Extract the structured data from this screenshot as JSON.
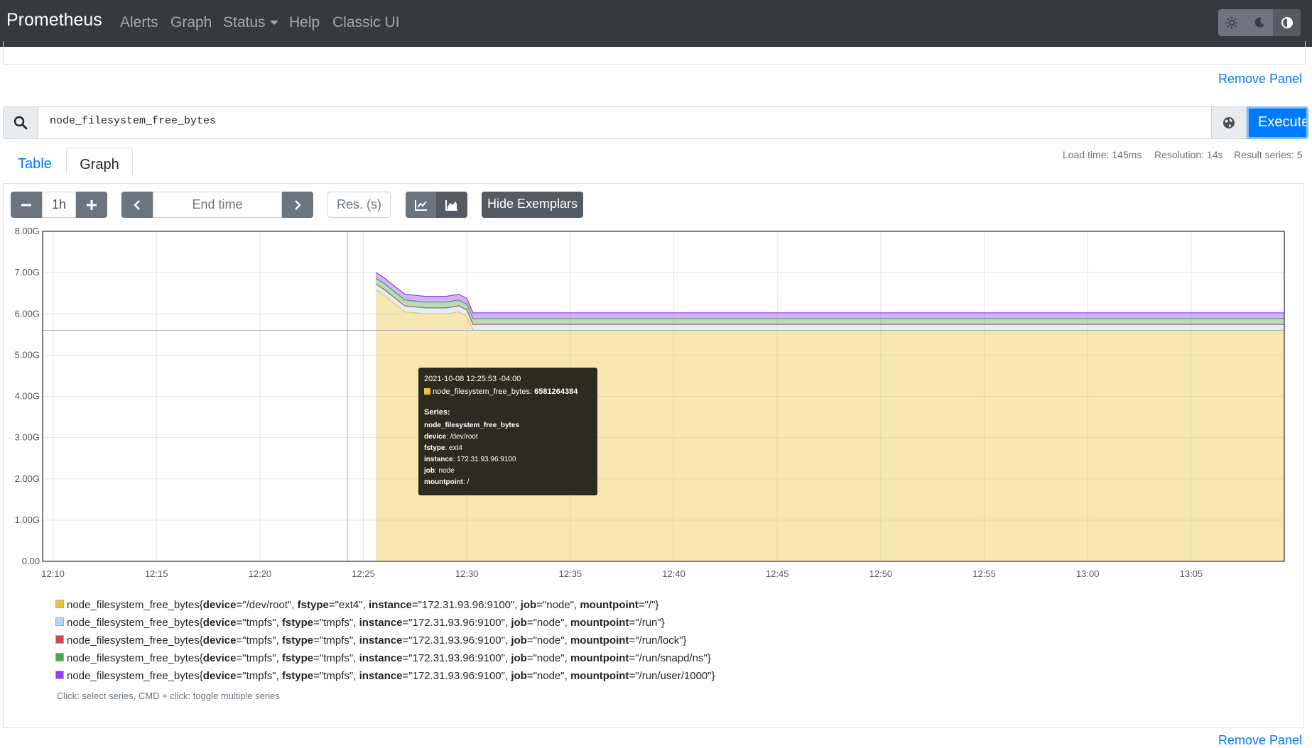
{
  "navbar": {
    "brand": "Prometheus",
    "items": [
      "Alerts",
      "Graph",
      "Status",
      "Help",
      "Classic UI"
    ],
    "theme_buttons": [
      "sun-icon",
      "moon-icon",
      "contrast-icon"
    ]
  },
  "panel": {
    "remove_label": "Remove Panel",
    "query": "node_filesystem_free_bytes",
    "execute_label": "Execute",
    "tabs": [
      "Table",
      "Graph"
    ],
    "stats": {
      "load_time": "Load time: 145ms",
      "resolution": "Resolution: 14s",
      "result_series": "Result series: 5"
    },
    "controls": {
      "range": "1h",
      "end_time_placeholder": "End time",
      "res_placeholder": "Res. (s)",
      "exemplars_label": "Hide Exemplars"
    }
  },
  "tooltip": {
    "timestamp": "2021-10-08 12:25:53 -04:00",
    "value_label": "node_filesystem_free_bytes:",
    "value": "6581264384",
    "series_heading": "Series:",
    "metric": "node_filesystem_free_bytes",
    "labels": [
      {
        "key": "device",
        "value": ": /dev/root"
      },
      {
        "key": "fstype",
        "value": ": ext4"
      },
      {
        "key": "instance",
        "value": ": 172.31.93.96:9100"
      },
      {
        "key": "job",
        "value": ": node"
      },
      {
        "key": "mountpoint",
        "value": ": /"
      }
    ]
  },
  "legend": {
    "hint": "Click: select series, CMD + click: toggle multiple series",
    "series": [
      {
        "color": "#edc240",
        "metric": "node_filesystem_free_bytes",
        "device": "\"/dev/root\"",
        "fstype": "\"ext4\"",
        "instance": "\"172.31.93.96:9100\"",
        "job": "\"node\"",
        "mountpoint": "\"/\""
      },
      {
        "color": "#afd8f8",
        "metric": "node_filesystem_free_bytes",
        "device": "\"tmpfs\"",
        "fstype": "\"tmpfs\"",
        "instance": "\"172.31.93.96:9100\"",
        "job": "\"node\"",
        "mountpoint": "\"/run\""
      },
      {
        "color": "#cb4b4b",
        "metric": "node_filesystem_free_bytes",
        "device": "\"tmpfs\"",
        "fstype": "\"tmpfs\"",
        "instance": "\"172.31.93.96:9100\"",
        "job": "\"node\"",
        "mountpoint": "\"/run/lock\""
      },
      {
        "color": "#4da74d",
        "metric": "node_filesystem_free_bytes",
        "device": "\"tmpfs\"",
        "fstype": "\"tmpfs\"",
        "instance": "\"172.31.93.96:9100\"",
        "job": "\"node\"",
        "mountpoint": "\"/run/snapd/ns\""
      },
      {
        "color": "#9440ed",
        "metric": "node_filesystem_free_bytes",
        "device": "\"tmpfs\"",
        "fstype": "\"tmpfs\"",
        "instance": "\"172.31.93.96:9100\"",
        "job": "\"node\"",
        "mountpoint": "\"/run/user/1000\""
      }
    ]
  },
  "chart_data": {
    "type": "area",
    "stacked": true,
    "title": "",
    "xlabel": "",
    "ylabel": "",
    "x_ticks": [
      "12:10",
      "12:15",
      "12:20",
      "12:25",
      "12:30",
      "12:35",
      "12:40",
      "12:45",
      "12:50",
      "12:55",
      "13:00",
      "13:05"
    ],
    "y_ticks": [
      "0.00",
      "1.00G",
      "2.00G",
      "3.00G",
      "4.00G",
      "5.00G",
      "6.00G",
      "7.00G",
      "8.00G"
    ],
    "ylim": [
      0,
      8
    ],
    "y_unit": "G",
    "x_unit": "minutes after 12:00",
    "xlim": [
      9.5,
      69.5
    ],
    "x": [
      25.6,
      26.0,
      27.0,
      28.0,
      29.0,
      29.6,
      30.0,
      30.3,
      69.5
    ],
    "series": [
      {
        "name": "node_filesystem_free_bytes{device=\"/dev/root\", fstype=\"ext4\", instance=\"172.31.93.96:9100\", job=\"node\", mountpoint=\"/\"}",
        "color": "#edc240",
        "values": [
          6.58,
          6.45,
          6.05,
          6.0,
          6.0,
          6.05,
          5.95,
          5.6,
          5.6
        ]
      },
      {
        "name": "node_filesystem_free_bytes{device=\"tmpfs\", fstype=\"tmpfs\", instance=\"172.31.93.96:9100\", job=\"node\", mountpoint=\"/run\"}",
        "color": "#afd8f8",
        "values": [
          0.14,
          0.14,
          0.14,
          0.14,
          0.14,
          0.14,
          0.14,
          0.14,
          0.14
        ]
      },
      {
        "name": "node_filesystem_free_bytes{device=\"tmpfs\", fstype=\"tmpfs\", instance=\"172.31.93.96:9100\", job=\"node\", mountpoint=\"/run/lock\"}",
        "color": "#cb4b4b",
        "values": [
          0.005,
          0.005,
          0.005,
          0.005,
          0.005,
          0.005,
          0.005,
          0.005,
          0.005
        ]
      },
      {
        "name": "node_filesystem_free_bytes{device=\"tmpfs\", fstype=\"tmpfs\", instance=\"172.31.93.96:9100\", job=\"node\", mountpoint=\"/run/snapd/ns\"}",
        "color": "#4da74d",
        "values": [
          0.14,
          0.14,
          0.14,
          0.14,
          0.14,
          0.14,
          0.14,
          0.14,
          0.14
        ]
      },
      {
        "name": "node_filesystem_free_bytes{device=\"tmpfs\", fstype=\"tmpfs\", instance=\"172.31.93.96:9100\", job=\"node\", mountpoint=\"/run/user/1000\"}",
        "color": "#9440ed",
        "values": [
          0.14,
          0.14,
          0.14,
          0.14,
          0.14,
          0.14,
          0.14,
          0.14,
          0.14
        ]
      }
    ],
    "grid": true,
    "legend": "bottom"
  }
}
